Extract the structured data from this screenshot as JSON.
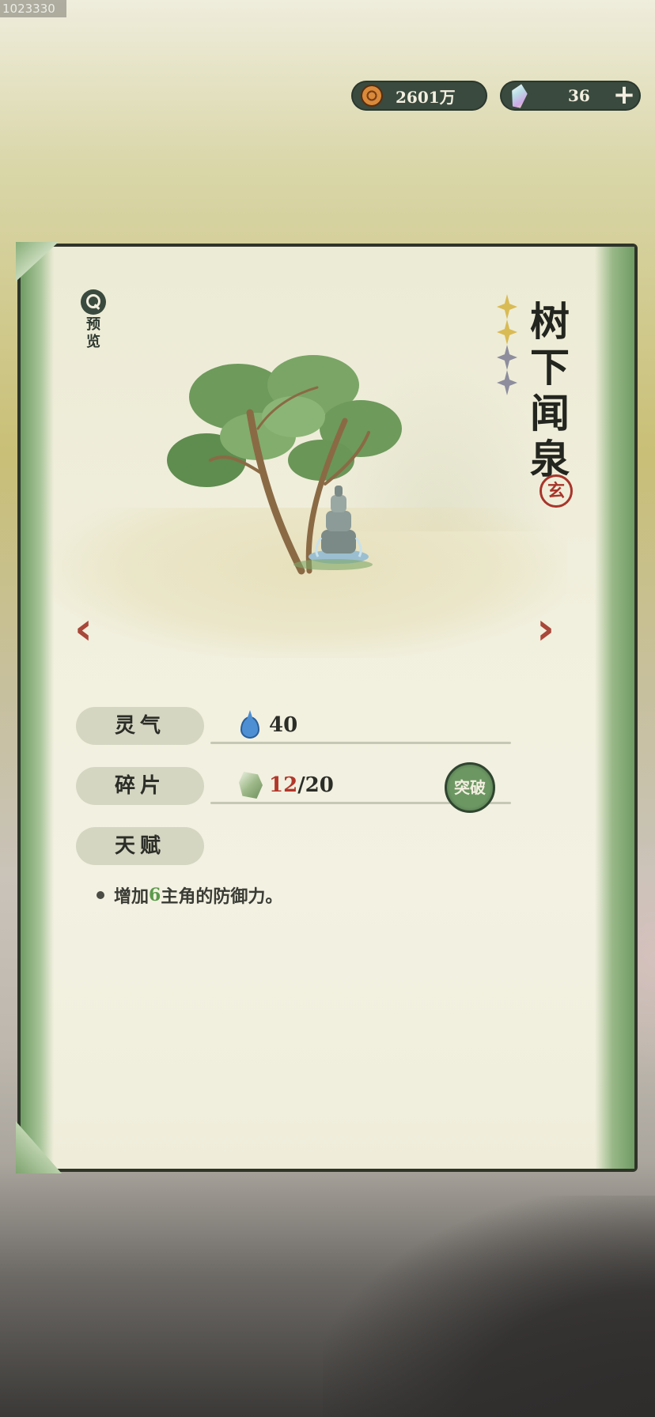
{
  "watermark": "1023330",
  "currency": {
    "coins": "2601万",
    "gems": "36",
    "add_label": "+"
  },
  "card": {
    "preview_label_1": "预",
    "preview_label_2": "览",
    "title_chars": [
      "树",
      "下",
      "闻",
      "泉"
    ],
    "stars": {
      "filled": 2,
      "total": 4
    },
    "grade_seal": "玄",
    "prev_arrow": "‹",
    "next_arrow": "›"
  },
  "stats": {
    "lingqi_label": "灵气",
    "lingqi_value": "40",
    "fragments_label": "碎片",
    "fragments_current": "12",
    "fragments_total": "/20",
    "breakthrough_label": "突破",
    "talent_label": "天赋",
    "talent_prefix": "增加",
    "talent_value": "6",
    "talent_suffix": "主角的防御力。"
  },
  "colors": {
    "accent_green": "#3a4a3e",
    "arrow_red": "#a8473a",
    "star_gold": "#d9bb55",
    "fragment_red": "#b2372b"
  },
  "icons": {
    "coin": "coin-icon",
    "gem": "gem-icon",
    "preview": "magnifier-icon",
    "lingqi": "water-drop-icon",
    "fragment": "fragment-icon"
  }
}
